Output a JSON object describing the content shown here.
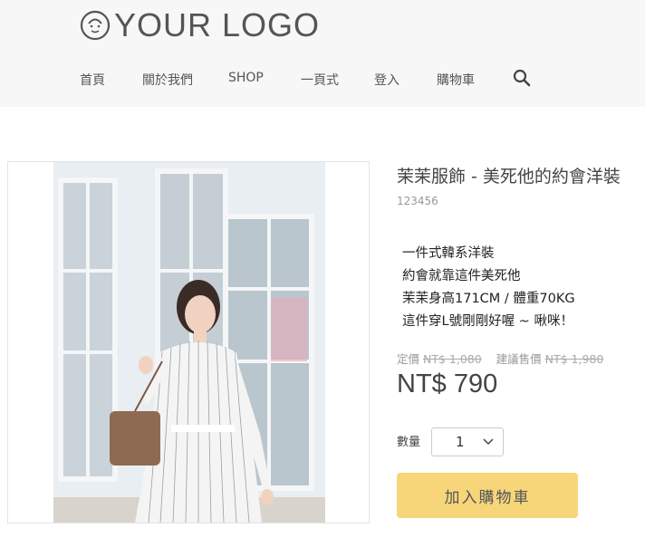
{
  "header": {
    "logo_text": "YOUR LOGO",
    "nav": [
      {
        "label": "首頁"
      },
      {
        "label": "關於我們"
      },
      {
        "label": "SHOP"
      },
      {
        "label": "一頁式"
      },
      {
        "label": "登入"
      },
      {
        "label": "購物車"
      }
    ],
    "search_icon": "search-icon"
  },
  "product": {
    "title": "茉茉服飾 - 美死他的約會洋裝",
    "sku": "123456",
    "description": [
      "一件式韓系洋裝",
      "約會就靠這件美死他",
      "茉茉身高171CM / 體重70KG",
      "這件穿L號剛剛好喔 ~ 啾咪！"
    ],
    "list_price_label": "定價",
    "list_price": "NT$ 1,080",
    "suggested_price_label": "建議售價",
    "suggested_price": "NT$ 1,980",
    "price": "NT$ 790",
    "quantity_label": "數量",
    "quantity": "1",
    "add_to_cart": "加入購物車"
  },
  "colors": {
    "header_bg": "#f7f7f7",
    "button_bg": "#f7d67a"
  }
}
